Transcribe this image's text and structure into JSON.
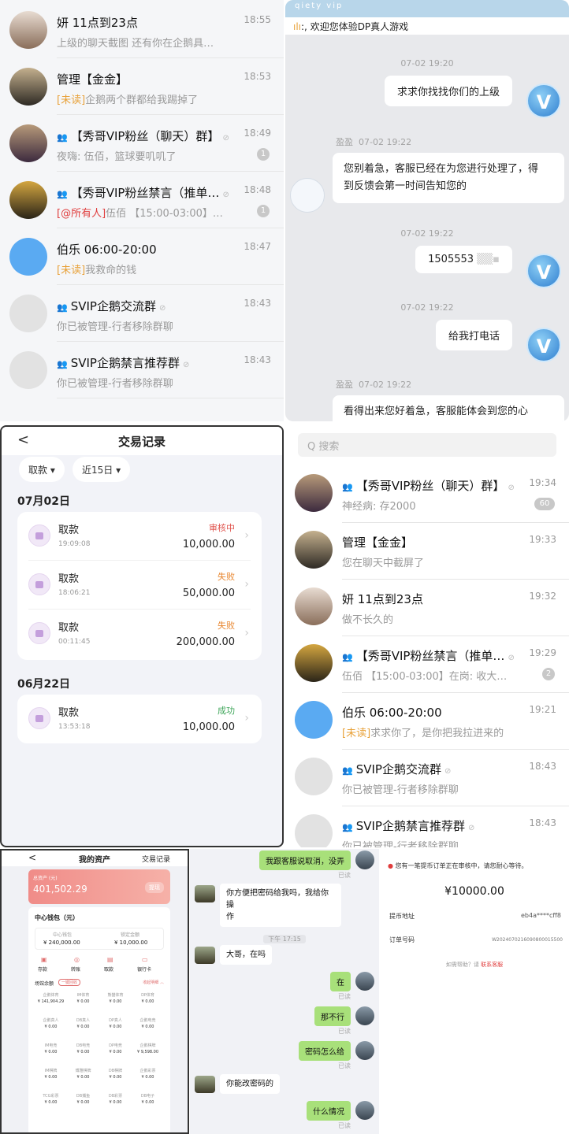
{
  "p1": {
    "chats": [
      {
        "name": "妍 11点到23点",
        "time": "18:55",
        "preview": "上级的聊天截图 还有你在企鹅具…",
        "tag": ""
      },
      {
        "name": "管理【金金】",
        "time": "18:53",
        "preview": "企鹅两个群都给我踢掉了",
        "tag": "[未读]"
      },
      {
        "name": "【秀哥VIP粉丝（聊天）群】",
        "time": "18:49",
        "preview": "夜嗨: 伍佰，篮球要叽叽了",
        "tag": "",
        "badge": "1"
      },
      {
        "name": "【秀哥VIP粉丝禁言（推单…",
        "time": "18:48",
        "preview": "伍佰 【15:00-03:00】…",
        "tag": "[@所有人]",
        "badge": "1"
      },
      {
        "name": "伯乐 06:00-20:00",
        "time": "18:47",
        "preview": "我救命的钱",
        "tag": "[未读]"
      },
      {
        "name": "SVIP企鹅交流群",
        "time": "18:43",
        "preview": "你已被管理-行者移除群聊",
        "tag": ""
      },
      {
        "name": "SVIP企鹅禁言推荐群",
        "time": "18:43",
        "preview": "你已被管理-行者移除群聊",
        "tag": ""
      }
    ]
  },
  "p2": {
    "banner": "qiety vip",
    "notice": ":, 欢迎您体验DP真人游戏",
    "t1": "07-02 19:20",
    "m1": "求求你找找你们的上级",
    "sender": "盈盈",
    "t2": "07-02 19:22",
    "m2a": "您别着急，客服已经在为您进行处理了，得",
    "m2b": "到反馈会第一时间告知您的",
    "t3": "07-02 19:22",
    "m3": "1505553",
    "t4": "07-02 19:22",
    "m4": "给我打电话",
    "t5": "07-02 19:22",
    "m5": "看得出来您好着急，客服能体会到您的心",
    "v": "V"
  },
  "p3": {
    "back": "<",
    "title": "交易记录",
    "filter1": "取款 ▾",
    "filter2": "近15日 ▾",
    "date1": "07月02日",
    "date2": "06月22日",
    "rows": [
      {
        "label": "取款",
        "time": "19:09:08",
        "status": "审核中",
        "amount": "10,000.00",
        "color": "#e0554f"
      },
      {
        "label": "取款",
        "time": "18:06:21",
        "status": "失败",
        "amount": "50,000.00",
        "color": "#e8862f"
      },
      {
        "label": "取款",
        "time": "00:11:45",
        "status": "失败",
        "amount": "200,000.00",
        "color": "#e8862f"
      },
      {
        "label": "取款",
        "time": "13:53:18",
        "status": "成功",
        "amount": "10,000.00",
        "color": "#3fa65a"
      }
    ]
  },
  "p4": {
    "search": "Q 搜索",
    "chats": [
      {
        "name": "【秀哥VIP粉丝（聊天）群】",
        "time": "19:34",
        "preview": "神经病: 存2000",
        "tag": "",
        "badge": "60"
      },
      {
        "name": "管理【金金】",
        "time": "19:33",
        "preview": "您在聊天中截屏了",
        "tag": ""
      },
      {
        "name": "妍 11点到23点",
        "time": "19:32",
        "preview": "做不长久的",
        "tag": ""
      },
      {
        "name": "【秀哥VIP粉丝禁言（推单…",
        "time": "19:29",
        "preview": "伍佰 【15:00-03:00】在岗: 收大…",
        "tag": "",
        "badge": "2"
      },
      {
        "name": "伯乐 06:00-20:00",
        "time": "19:21",
        "preview": "求求你了，是你把我拉进来的",
        "tag": "[未读]"
      },
      {
        "name": "SVIP企鹅交流群",
        "time": "18:43",
        "preview": "你已被管理-行者移除群聊",
        "tag": ""
      },
      {
        "name": "SVIP企鹅禁言推荐群",
        "time": "18:43",
        "preview": "你已被管理-行者移除群聊",
        "tag": ""
      }
    ]
  },
  "p5": {
    "back": "<",
    "title": "我的资产",
    "link": "交易记录",
    "total_label": "总资产 (元)",
    "total": "401,502.29",
    "btn": "提现",
    "wallet": "中心钱包（元）",
    "w1_label": "中心钱包",
    "w1": "¥ 240,000.00",
    "w2_label": "锁定金额",
    "w2": "¥ 10,000.00",
    "actions": [
      "存款",
      "转账",
      "取款",
      "银行卡"
    ],
    "venue": "场馆余额",
    "venue_btn": "一键回收",
    "collapse": "收起明细 ︿",
    "grid": [
      [
        "企鹅体育",
        "¥ 141,904.29"
      ],
      [
        "IM体育",
        "¥ 0.00"
      ],
      [
        "熊猫体育",
        "¥ 0.00"
      ],
      [
        "DP体育",
        "¥ 0.00"
      ],
      [
        "企鹅真人",
        "¥ 0.00"
      ],
      [
        "DB真人",
        "¥ 0.00"
      ],
      [
        "DP真人",
        "¥ 0.00"
      ],
      [
        "企鹅电竞",
        "¥ 0.00"
      ],
      [
        "IM电竞",
        "¥ 0.00"
      ],
      [
        "DB电竞",
        "¥ 0.00"
      ],
      [
        "DP电竞",
        "¥ 0.00"
      ],
      [
        "企鹅棋牌",
        "¥ 9,598.00"
      ],
      [
        "IM棋牌",
        "¥ 0.00"
      ],
      [
        "博雅棋牌",
        "¥ 0.00"
      ],
      [
        "DB棋牌",
        "¥ 0.00"
      ],
      [
        "企鹅彩票",
        "¥ 0.00"
      ],
      [
        "TCG彩票",
        "¥ 0.00"
      ],
      [
        "DB捕鱼",
        "¥ 0.00"
      ],
      [
        "DB彩票",
        "¥ 0.00"
      ],
      [
        "DB电子",
        "¥ 0.00"
      ]
    ]
  },
  "p6": {
    "m1": "我跟客服说取消，没弄",
    "read": "已读",
    "m2a": "你方便把密码给我吗，我给你操",
    "m2b": "作",
    "ts": "下午 17:15",
    "m3": "大哥，在吗",
    "m4": "在",
    "m5": "那不行",
    "m6": "密码怎么给",
    "m7": "你能改密码的",
    "m8": "什么情况"
  },
  "p7": {
    "notice": "您有一笔提币订单正在审核中，请您耐心等待。",
    "amount": "¥10000.00",
    "addr_label": "提币地址",
    "addr": "eb4a****cff8",
    "order_label": "订单号码",
    "order": "W2024070216090800015500",
    "help": "如需帮助？请",
    "help_link": "联系客服"
  },
  "colors": {
    "accent_orange": "#e8a23a",
    "accent_red": "#e03d3d",
    "bubble_green": "#a8e07a",
    "asset_pink": "#f09a94"
  }
}
